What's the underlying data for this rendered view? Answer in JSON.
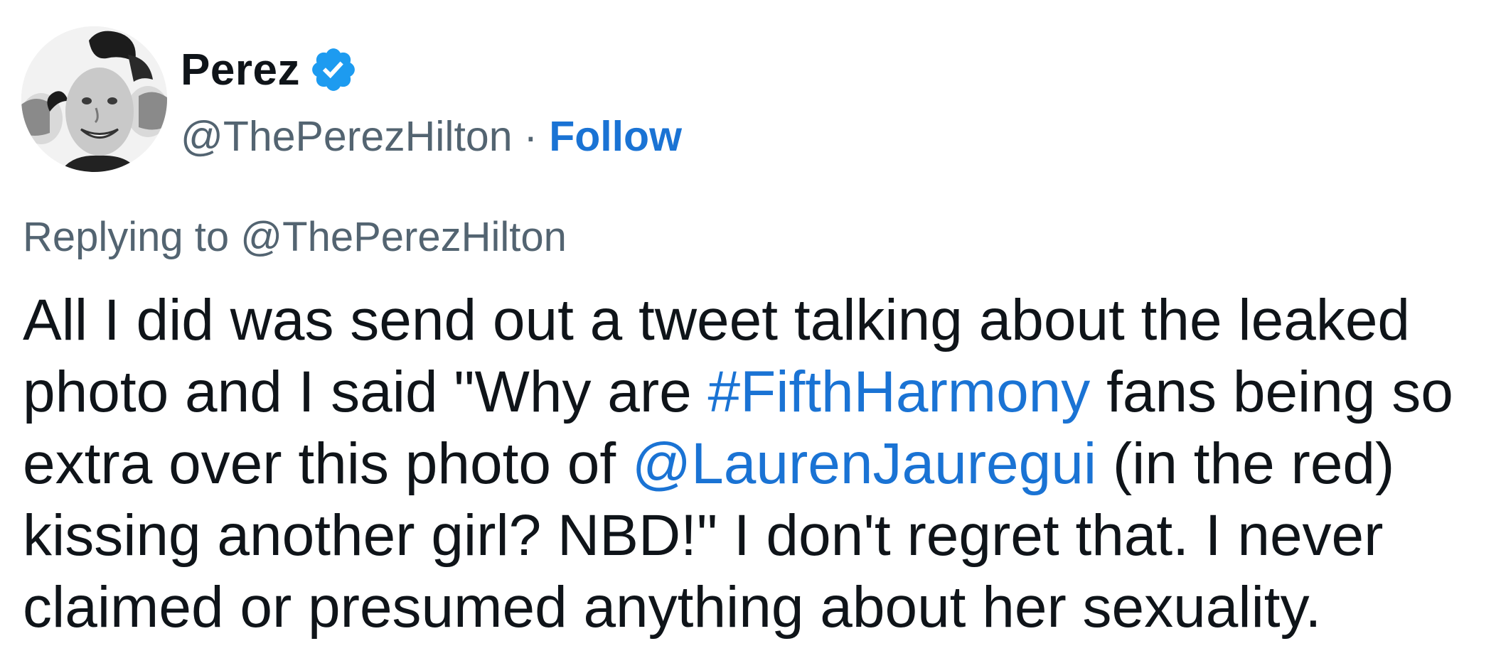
{
  "author": {
    "display_name": "Perez",
    "handle": "@ThePerezHilton",
    "separator": "·",
    "follow_label": "Follow",
    "verified": true
  },
  "reply": {
    "prefix": "Replying to",
    "handle": "@ThePerezHilton"
  },
  "tweet": {
    "line1": "All I did was send out a tweet talking about the leaked",
    "line2_before": "photo and I said \"Why are ",
    "hashtag": "#FifthHarmony",
    "line2_after": " fans being so",
    "line3_before": "extra over this photo of ",
    "mention": "@LaurenJauregui",
    "line3_after": " (in the red)",
    "line4": "kissing another girl? NBD!\" I don't regret that. I never",
    "line5": "claimed or presumed anything about her sexuality."
  },
  "colors": {
    "link": "#1a73d4",
    "secondary_text": "#536471",
    "primary_text": "#0f1419",
    "verified_badge": "#1d9bf0"
  }
}
